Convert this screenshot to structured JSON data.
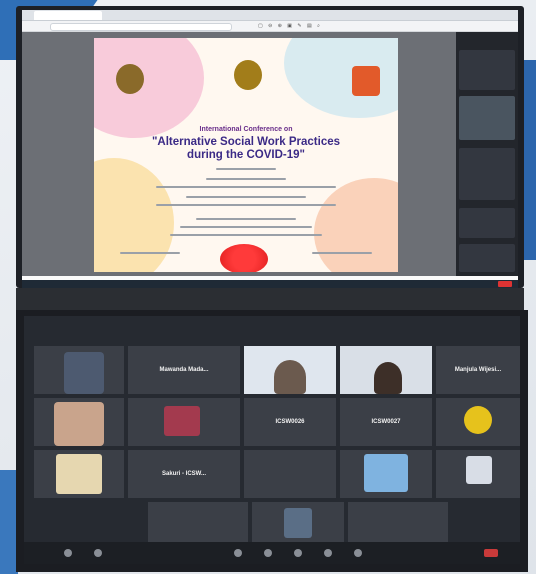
{
  "certificate": {
    "heading": "International Conference on",
    "title_line1": "\"Alternative Social Work Practices",
    "title_line2": "during the COVID-19\""
  },
  "colors": {
    "cert_heading": "#6a2f8b",
    "cert_title": "#3b2a86",
    "seal": "#e01e1e",
    "zoom_bg": "#262a31",
    "leave_button": "#d33333"
  },
  "zoom_gallery": {
    "tiles": [
      {
        "name": "Mawanda Mada..."
      },
      {
        "name": "Manjula Wijesi..."
      },
      {
        "name": "ICSW0026"
      },
      {
        "name": "ICSW0027"
      },
      {
        "name": "Sakuri - ICSW..."
      }
    ]
  }
}
